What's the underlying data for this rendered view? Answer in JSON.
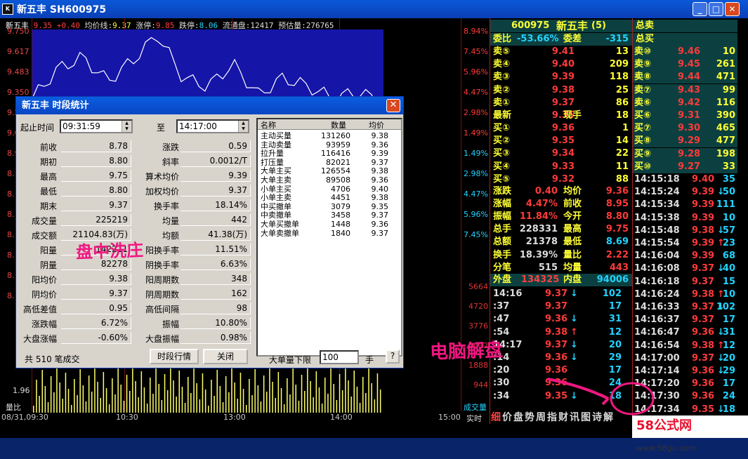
{
  "title": "新五丰  SH600975",
  "title_icon": "app-icon",
  "colors": {
    "up": "#ff3a3a",
    "down": "#22d3ff",
    "neutral": "#dddddd",
    "label": "#c8c8ff",
    "yellow": "#ffff33",
    "plotbg": "#1515a8"
  },
  "chart": {
    "header": {
      "name": "新五丰",
      "price": "9.35",
      "change": "+0.40",
      "avg_label": "均价线:",
      "avg": "9.37",
      "limit_up_label": "涨停:",
      "limit_up": "9.85",
      "limit_down_label": "跌停:",
      "limit_down": "8.06",
      "float_label": "流通盘:",
      "float": "12417",
      "est_label": "预估量:",
      "est": "276765"
    },
    "left_prices": [
      "9.750",
      "9.617",
      "9.483",
      "9.350",
      "9.2",
      "9.0",
      "8.9",
      "8.",
      "8.",
      "8.",
      "8.",
      "8.",
      "8.",
      "8."
    ],
    "left_vol": [
      "1.96"
    ],
    "vol_label": "量比",
    "right_pct": [
      "8.94%",
      "7.45%",
      "5.96%",
      "4.47%",
      "2.98%",
      "1.49%",
      "1.49%",
      "2.98%",
      "4.47%",
      "5.96%",
      "7.45%"
    ],
    "right_vol": [
      "5664",
      "4720",
      "3776",
      "2832",
      "1888",
      "944"
    ],
    "vol_word": "成交量",
    "x_labels": [
      "08/31,09:30",
      "10:30",
      "13:00",
      "14:00",
      "15:00",
      "实时"
    ],
    "chart_data": {
      "type": "line",
      "title": "",
      "x": [
        "09:30",
        "10:30",
        "13:00",
        "14:00",
        "15:00"
      ],
      "ylim": [
        8.06,
        9.85
      ],
      "series": [
        {
          "name": "",
          "values": [
            9.38,
            9.55,
            9.62,
            9.48,
            9.6,
            9.75,
            9.5,
            9.45,
            9.58,
            9.4,
            9.5,
            9.45,
            9.38,
            9.42,
            9.35
          ]
        }
      ]
    }
  },
  "quote": {
    "code": "600975",
    "name": "新五丰",
    "suffix": "(5)",
    "summary_label": "总卖",
    "summary_label2": "总买",
    "wb_label": "委比",
    "wb": "-53.66%",
    "wc_label": "委差",
    "wc": "-315",
    "asks": [
      {
        "l": "卖⑤",
        "p": "9.41",
        "v": "13"
      },
      {
        "l": "卖④",
        "p": "9.40",
        "v": "209"
      },
      {
        "l": "卖③",
        "p": "9.39",
        "v": "118"
      },
      {
        "l": "卖②",
        "p": "9.38",
        "v": "25"
      },
      {
        "l": "卖①",
        "p": "9.37",
        "v": "86"
      }
    ],
    "last_label": "最新",
    "last": "9.35",
    "now_label": "现手",
    "now": "18",
    "bids": [
      {
        "l": "买①",
        "p": "9.36",
        "v": "1"
      },
      {
        "l": "买②",
        "p": "9.35",
        "v": "14"
      },
      {
        "l": "买③",
        "p": "9.34",
        "v": "22"
      },
      {
        "l": "买④",
        "p": "9.33",
        "v": "11"
      },
      {
        "l": "买⑤",
        "p": "9.32",
        "v": "88"
      }
    ],
    "stats": [
      {
        "l1": "涨跌",
        "v1": "0.40",
        "l2": "均价",
        "v2": "9.36"
      },
      {
        "l1": "涨幅",
        "v1": "4.47%",
        "l2": "前收",
        "v2": "8.95"
      },
      {
        "l1": "振幅",
        "v1": "11.84%",
        "l2": "今开",
        "v2": "8.80"
      },
      {
        "l1": "总手",
        "v1": "228331",
        "l2": "最高",
        "v2": "9.75"
      },
      {
        "l1": "总额",
        "v1": "21378",
        "l2": "最低",
        "v2": "8.69"
      },
      {
        "l1": "换手",
        "v1": "18.39%",
        "l2": "量比",
        "v2": "2.22"
      },
      {
        "l1": "分笔",
        "v1": "515",
        "l2": "均量",
        "v2": "443"
      }
    ],
    "outer_label": "外盘",
    "outer": "134325",
    "inner_label": "内盘",
    "inner": "94006",
    "ticks": [
      {
        "t": "14:16",
        "p": "9.37",
        "a": "↓",
        "v": "102"
      },
      {
        "t": ":37",
        "p": "9.37",
        "a": "",
        "v": "17"
      },
      {
        "t": ":47",
        "p": "9.36",
        "a": "↓",
        "v": "31"
      },
      {
        "t": ":54",
        "p": "9.38",
        "a": "↑",
        "v": "12"
      },
      {
        "t": "14:17",
        "p": "9.37",
        "a": "↓",
        "v": "20"
      },
      {
        "t": ":14",
        "p": "9.36",
        "a": "↓",
        "v": "29"
      },
      {
        "t": ":20",
        "p": "9.36",
        "a": "",
        "v": "17"
      },
      {
        "t": ":30",
        "p": "9.36",
        "a": "",
        "v": "24"
      },
      {
        "t": ":34",
        "p": "9.35",
        "a": "↓",
        "v": "18"
      }
    ],
    "tabs": [
      "细",
      "价",
      "盘",
      "势",
      "周",
      "指",
      "财",
      "讯",
      "图",
      "诗",
      "解"
    ]
  },
  "side": {
    "asks": [
      {
        "l": "卖⑩",
        "p": "9.46",
        "v": "10"
      },
      {
        "l": "卖⑨",
        "p": "9.45",
        "v": "261"
      },
      {
        "l": "卖⑧",
        "p": "9.44",
        "v": "471"
      },
      {
        "l": "卖⑦",
        "p": "9.43",
        "v": "99"
      },
      {
        "l": "卖⑥",
        "p": "9.42",
        "v": "116"
      }
    ],
    "bids": [
      {
        "l": "买⑥",
        "p": "9.31",
        "v": "390"
      },
      {
        "l": "买⑦",
        "p": "9.30",
        "v": "465"
      },
      {
        "l": "买⑧",
        "p": "9.29",
        "v": "477"
      },
      {
        "l": "买⑨",
        "p": "9.28",
        "v": "198"
      },
      {
        "l": "买⑩",
        "p": "9.27",
        "v": "33"
      }
    ],
    "ticks": [
      {
        "t": "14:15:18",
        "p": "9.40",
        "a": "",
        "v": "35"
      },
      {
        "t": "14:15:24",
        "p": "9.39",
        "a": "↓",
        "v": "50"
      },
      {
        "t": "14:15:34",
        "p": "9.39",
        "a": "",
        "v": "111"
      },
      {
        "t": "14:15:38",
        "p": "9.39",
        "a": "",
        "v": "10"
      },
      {
        "t": "14:15:48",
        "p": "9.38",
        "a": "↓",
        "v": "57"
      },
      {
        "t": "14:15:54",
        "p": "9.39",
        "a": "↑",
        "v": "23"
      },
      {
        "t": "14:16:04",
        "p": "9.39",
        "a": "",
        "v": "68"
      },
      {
        "t": "14:16:08",
        "p": "9.37",
        "a": "↓",
        "v": "40"
      },
      {
        "t": "14:16:18",
        "p": "9.37",
        "a": "",
        "v": "15"
      },
      {
        "t": "14:16:24",
        "p": "9.38",
        "a": "↑",
        "v": "10"
      },
      {
        "t": "14:16:33",
        "p": "9.37",
        "a": "↓",
        "v": "102"
      },
      {
        "t": "14:16:37",
        "p": "9.37",
        "a": "",
        "v": "17"
      },
      {
        "t": "14:16:47",
        "p": "9.36",
        "a": "↓",
        "v": "31"
      },
      {
        "t": "14:16:54",
        "p": "9.38",
        "a": "↑",
        "v": "12"
      },
      {
        "t": "14:17:00",
        "p": "9.37",
        "a": "↓",
        "v": "20"
      },
      {
        "t": "14:17:14",
        "p": "9.36",
        "a": "↓",
        "v": "29"
      },
      {
        "t": "14:17:20",
        "p": "9.36",
        "a": "",
        "v": "17"
      },
      {
        "t": "14:17:30",
        "p": "9.36",
        "a": "",
        "v": "24"
      },
      {
        "t": "14:17:34",
        "p": "9.35",
        "a": "↓",
        "v": "18"
      }
    ]
  },
  "dialog": {
    "title": "新五丰  时段统计",
    "start_label": "起止时间",
    "start": "09:31:59",
    "to_label": "至",
    "end": "14:17:00",
    "left": [
      [
        "前收",
        "8.78"
      ],
      [
        "期初",
        "8.80"
      ],
      [
        "最高",
        "9.75"
      ],
      [
        "最低",
        "8.80"
      ],
      [
        "期末",
        "9.37"
      ],
      [
        "成交量",
        "225219"
      ],
      [
        "成交额",
        "21104.83(万)"
      ],
      [
        "阳量",
        "142211"
      ],
      [
        "阴量",
        "82278"
      ],
      [
        "阳均价",
        "9.38"
      ],
      [
        "阴均价",
        "9.37"
      ],
      [
        "高低差值",
        "0.95"
      ],
      [
        "涨跌幅",
        "6.72%"
      ],
      [
        "大盘涨幅",
        "-0.60%"
      ]
    ],
    "right": [
      [
        "涨跌",
        "0.59"
      ],
      [
        "斜率",
        "0.0012/T"
      ],
      [
        "算术均价",
        "9.39"
      ],
      [
        "加权均价",
        "9.37"
      ],
      [
        "换手率",
        "18.14%"
      ],
      [
        "均量",
        "442"
      ],
      [
        "均额",
        "41.38(万)"
      ],
      [
        "阳换手率",
        "11.51%"
      ],
      [
        "阴换手率",
        "6.63%"
      ],
      [
        "阳周期数",
        "348"
      ],
      [
        "阴周期数",
        "162"
      ],
      [
        "高低间隔",
        "98"
      ],
      [
        "振幅",
        "10.80%"
      ],
      [
        "大盘振幅",
        "0.98%"
      ]
    ],
    "list_head": [
      "名称",
      "数量",
      "均价"
    ],
    "list": [
      [
        "主动买量",
        "131260",
        "9.38"
      ],
      [
        "主动卖量",
        "93959",
        "9.36"
      ],
      [
        "拉升量",
        "116416",
        "9.39"
      ],
      [
        "打压量",
        "82021",
        "9.37"
      ],
      [
        "大单主买",
        "126554",
        "9.38"
      ],
      [
        "大单主卖",
        "89508",
        "9.36"
      ],
      [
        "小单主买",
        "4706",
        "9.40"
      ],
      [
        "小单主卖",
        "4451",
        "9.38"
      ],
      [
        "中买撤单",
        "3079",
        "9.35"
      ],
      [
        "中卖撤单",
        "3458",
        "9.37"
      ],
      [
        "大单买撤单",
        "1448",
        "9.36"
      ],
      [
        "大单卖撤单",
        "1840",
        "9.37"
      ]
    ],
    "footer": "共 510 笔成交",
    "btn_period": "时段行情",
    "btn_close": "关闭",
    "big_label": "大单量下限",
    "big_value": "100",
    "unit": "手",
    "help": "?"
  },
  "annotations": {
    "a1": "盘中洗庄",
    "a2": "电脑解盘"
  },
  "watermark": {
    "brand": "58公式网",
    "url": "www.58gu.com"
  }
}
